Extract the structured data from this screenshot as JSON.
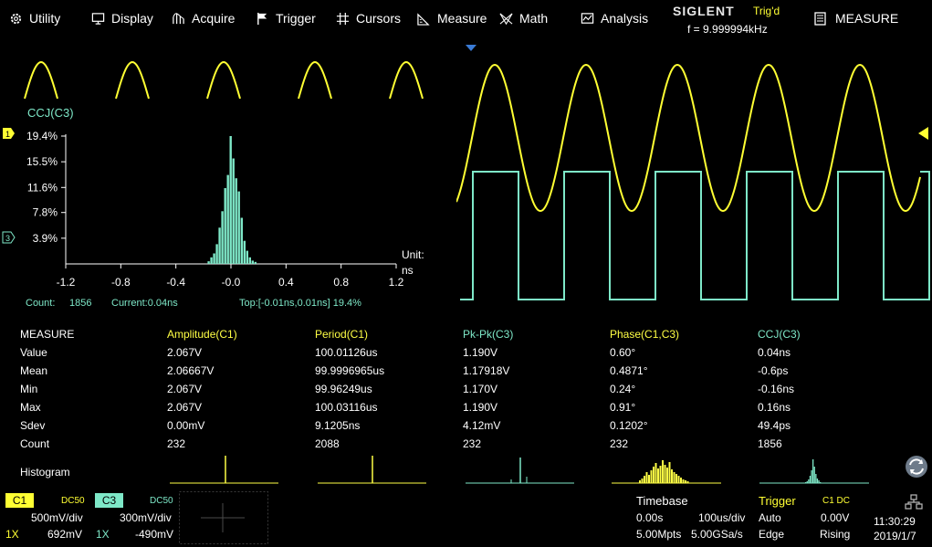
{
  "menu": {
    "utility": "Utility",
    "display": "Display",
    "acquire": "Acquire",
    "trigger": "Trigger",
    "cursors": "Cursors",
    "measure": "Measure",
    "math": "Math",
    "analysis": "Analysis",
    "measure_panel": "MEASURE"
  },
  "status": {
    "brand": "SIGLENT",
    "trig_state": "Trig'd",
    "frequency": "f = 9.999994kHz"
  },
  "histogram": {
    "title": "CCJ(C3)",
    "unit_label": "Unit:",
    "unit": "ns",
    "count_label": "Count:",
    "count": "1856",
    "current": "Current:0.04ns",
    "top": "Top:[-0.01ns,0.01ns] 19.4%",
    "marker_1": "1",
    "marker_3": "3",
    "chart_data": {
      "type": "bar",
      "x_ticks": [
        "-1.2",
        "-0.8",
        "-0.4",
        "-0.0",
        "0.4",
        "0.8",
        "1.2"
      ],
      "y_ticks": [
        "19.4%",
        "15.5%",
        "11.6%",
        "7.8%",
        "3.9%"
      ],
      "ylim": [
        0,
        19.4
      ],
      "xlim": [
        -1.2,
        1.2
      ],
      "bin_centers": [
        -0.16,
        -0.14,
        -0.12,
        -0.1,
        -0.08,
        -0.06,
        -0.04,
        -0.02,
        0.0,
        0.02,
        0.04,
        0.06,
        0.08,
        0.1,
        0.12,
        0.14,
        0.16,
        0.18
      ],
      "values": [
        0.4,
        1.0,
        1.6,
        3.0,
        5.5,
        8.0,
        11.5,
        13.5,
        19.4,
        16.0,
        13.0,
        11.0,
        7.0,
        3.5,
        2.0,
        1.0,
        0.5,
        0.3
      ]
    }
  },
  "measure": {
    "header": "MEASURE",
    "columns": [
      "Amplitude(C1)",
      "Period(C1)",
      "Pk-Pk(C3)",
      "Phase(C1,C3)",
      "CCJ(C3)"
    ],
    "column_colors": [
      "#ffff44",
      "#ffff44",
      "#7ee8c8",
      "#ffff44",
      "#7ee8c8"
    ],
    "rows": [
      {
        "label": "Value",
        "cells": [
          "2.067V",
          "100.01126us",
          "1.190V",
          "0.60°",
          "0.04ns"
        ]
      },
      {
        "label": "Mean",
        "cells": [
          "2.06667V",
          "99.9996965us",
          "1.17918V",
          "0.4871°",
          "-0.6ps"
        ]
      },
      {
        "label": "Min",
        "cells": [
          "2.067V",
          "99.96249us",
          "1.170V",
          "0.24°",
          "-0.16ns"
        ]
      },
      {
        "label": "Max",
        "cells": [
          "2.067V",
          "100.03116us",
          "1.190V",
          "0.91°",
          "0.16ns"
        ]
      },
      {
        "label": "Sdev",
        "cells": [
          "0.00mV",
          "9.1205ns",
          "4.12mV",
          "0.1202°",
          "49.4ps"
        ]
      },
      {
        "label": "Count",
        "cells": [
          "232",
          "2088",
          "232",
          "232",
          "1856"
        ]
      }
    ],
    "histogram_label": "Histogram"
  },
  "channels": {
    "c1": {
      "label": "C1",
      "coupling": "DC50",
      "scale": "500mV/div",
      "probe": "1X",
      "offset": "692mV",
      "color": "#ffff33"
    },
    "c3": {
      "label": "C3",
      "coupling": "DC50",
      "scale": "300mV/div",
      "probe": "1X",
      "offset": "-490mV",
      "color": "#7ee8c8"
    }
  },
  "timebase": {
    "label": "Timebase",
    "delay": "0.00s",
    "scale": "100us/div",
    "memory": "5.00Mpts",
    "sample_rate": "5.00GSa/s"
  },
  "trigger": {
    "label": "Trigger",
    "source": "C1 DC",
    "mode": "Auto",
    "level": "0.00V",
    "type": "Edge",
    "slope": "Rising"
  },
  "clock": {
    "time": "11:30:29",
    "date": "2019/1/7"
  },
  "colors": {
    "ch1": "#ffff33",
    "ch3": "#7ee8c8",
    "text": "#ffffff"
  }
}
